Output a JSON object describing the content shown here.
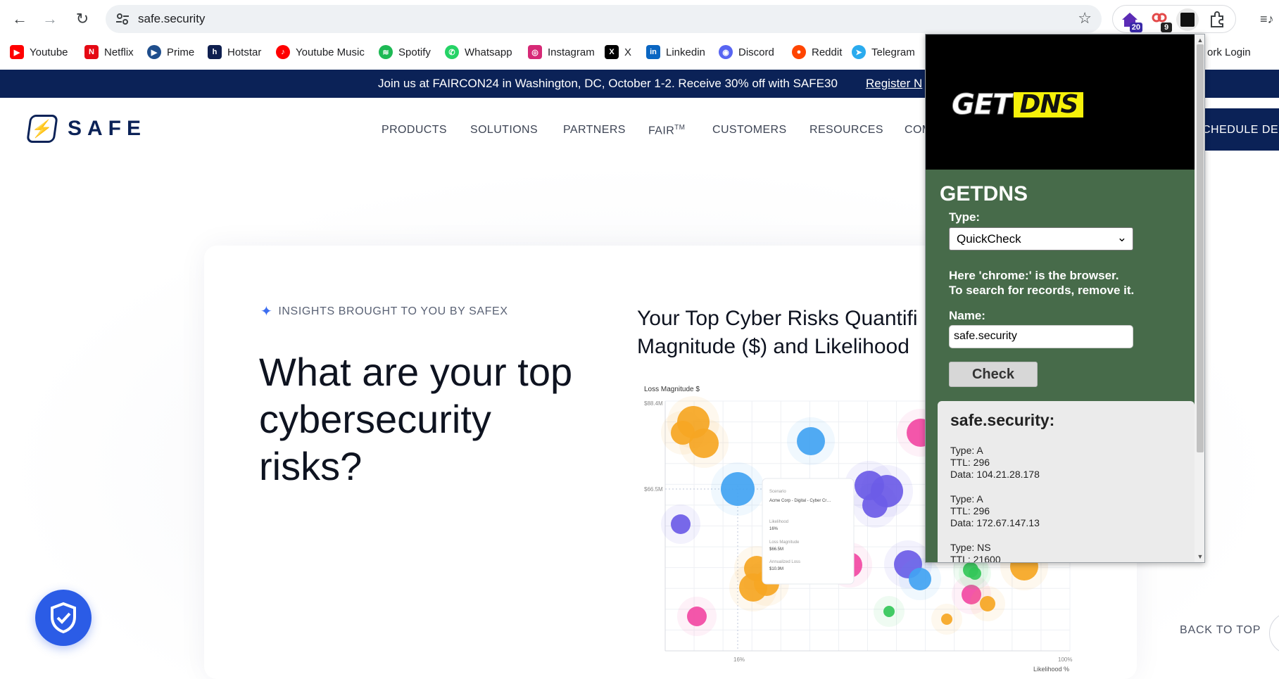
{
  "browser": {
    "url": "safe.security",
    "extension_badges": [
      "20",
      "9"
    ],
    "bookmarks": [
      {
        "label": "Youtube",
        "icon": "youtube-icon",
        "color": "#ff0000"
      },
      {
        "label": "Netflix",
        "icon": "netflix-icon",
        "color": "#e50914"
      },
      {
        "label": "Prime",
        "icon": "prime-video-icon",
        "color": "#1f4e8c"
      },
      {
        "label": "Hotstar",
        "icon": "hotstar-icon",
        "color": "#0f1f4f"
      },
      {
        "label": "Youtube Music",
        "icon": "youtube-music-icon",
        "color": "#ff0000"
      },
      {
        "label": "Spotify",
        "icon": "spotify-icon",
        "color": "#1db954"
      },
      {
        "label": "Whatsapp",
        "icon": "whatsapp-icon",
        "color": "#25d366"
      },
      {
        "label": "Instagram",
        "icon": "instagram-icon",
        "color": "#d62976"
      },
      {
        "label": "X",
        "icon": "x-icon",
        "color": "#000000"
      },
      {
        "label": "Linkedin",
        "icon": "linkedin-icon",
        "color": "#0a66c2"
      },
      {
        "label": "Discord",
        "icon": "discord-icon",
        "color": "#5865f2"
      },
      {
        "label": "Reddit",
        "icon": "reddit-icon",
        "color": "#ff4500"
      },
      {
        "label": "Telegram",
        "icon": "telegram-icon",
        "color": "#2aabee"
      }
    ],
    "bookmark_partial": "ork Login"
  },
  "site": {
    "banner_text": "Join us at FAIRCON24 in Washington, DC, October 1-2. Receive 30% off with SAFE30",
    "banner_link": "Register N",
    "logo_text": "SAFE",
    "nav": [
      "PRODUCTS",
      "SOLUTIONS",
      "PARTNERS",
      "FAIR",
      "CUSTOMERS",
      "RESOURCES",
      "COM"
    ],
    "nav_fair_sup": "TM",
    "schedule_button": "CHEDULE DEM",
    "insights_label": "INSIGHTS BROUGHT TO YOU BY SAFEX",
    "hero_title": "What are your top cybersecurity risks?",
    "chart_title_line1": "Your Top Cyber Risks Quantifi",
    "chart_title_line2": "Magnitude ($) and Likelihood",
    "back_to_top": "BACK TO TOP"
  },
  "chart_data": {
    "type": "scatter",
    "ylabel": "Loss Magnitude $",
    "xlabel": "Likelihood %",
    "y_ticks": [
      "$88.4M",
      "$66.5M"
    ],
    "x_ticks": [
      "16%",
      "100%"
    ],
    "tooltip": {
      "scenario_label": "Scenario",
      "scenario": "Acme Corp - Digital - Cyber Criminals - Ransomware with Data Exfiltration",
      "likelihood_label": "Likelihood",
      "likelihood": "16%",
      "magnitude_label": "Loss Magnitude",
      "magnitude": "$66.5M",
      "annualized_label": "Annualized Loss",
      "annualized": "$10.9M"
    }
  },
  "popup": {
    "logo_get": "GET",
    "logo_dns": "DNS",
    "title": "GETDNS",
    "type_label": "Type:",
    "type_value": "QuickCheck",
    "note_line1": "Here 'chrome:' is the browser.",
    "note_line2": "To search for records, remove it.",
    "name_label": "Name:",
    "name_value": "safe.security",
    "check_button": "Check",
    "result_host": "safe.security:",
    "records": [
      {
        "type": "Type: A",
        "ttl": "TTL: 296",
        "data": "Data: 104.21.28.178"
      },
      {
        "type": "Type: A",
        "ttl": "TTL: 296",
        "data": "Data: 172.67.147.13"
      },
      {
        "type": "Type: NS",
        "ttl": "TTL: 21600",
        "data": ""
      }
    ]
  }
}
